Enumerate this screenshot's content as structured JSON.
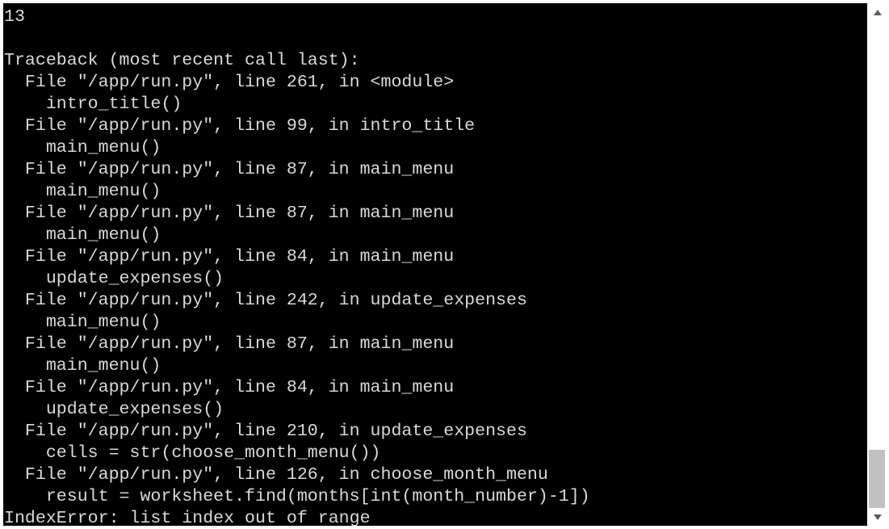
{
  "terminal": {
    "lines": [
      "13",
      "",
      "Traceback (most recent call last):",
      "  File \"/app/run.py\", line 261, in <module>",
      "    intro_title()",
      "  File \"/app/run.py\", line 99, in intro_title",
      "    main_menu()",
      "  File \"/app/run.py\", line 87, in main_menu",
      "    main_menu()",
      "  File \"/app/run.py\", line 87, in main_menu",
      "    main_menu()",
      "  File \"/app/run.py\", line 84, in main_menu",
      "    update_expenses()",
      "  File \"/app/run.py\", line 242, in update_expenses",
      "    main_menu()",
      "  File \"/app/run.py\", line 87, in main_menu",
      "    main_menu()",
      "  File \"/app/run.py\", line 84, in main_menu",
      "    update_expenses()",
      "  File \"/app/run.py\", line 210, in update_expenses",
      "    cells = str(choose_month_menu())",
      "  File \"/app/run.py\", line 126, in choose_month_menu",
      "    result = worksheet.find(months[int(month_number)-1])",
      "IndexError: list index out of range"
    ],
    "background_color": "#000000",
    "text_color": "#d9d9d9"
  },
  "scrollbar": {
    "up_icon": "arrow-up-icon",
    "down_icon": "arrow-down-icon",
    "position_fraction": 1.0,
    "visible_fraction": 0.12
  }
}
